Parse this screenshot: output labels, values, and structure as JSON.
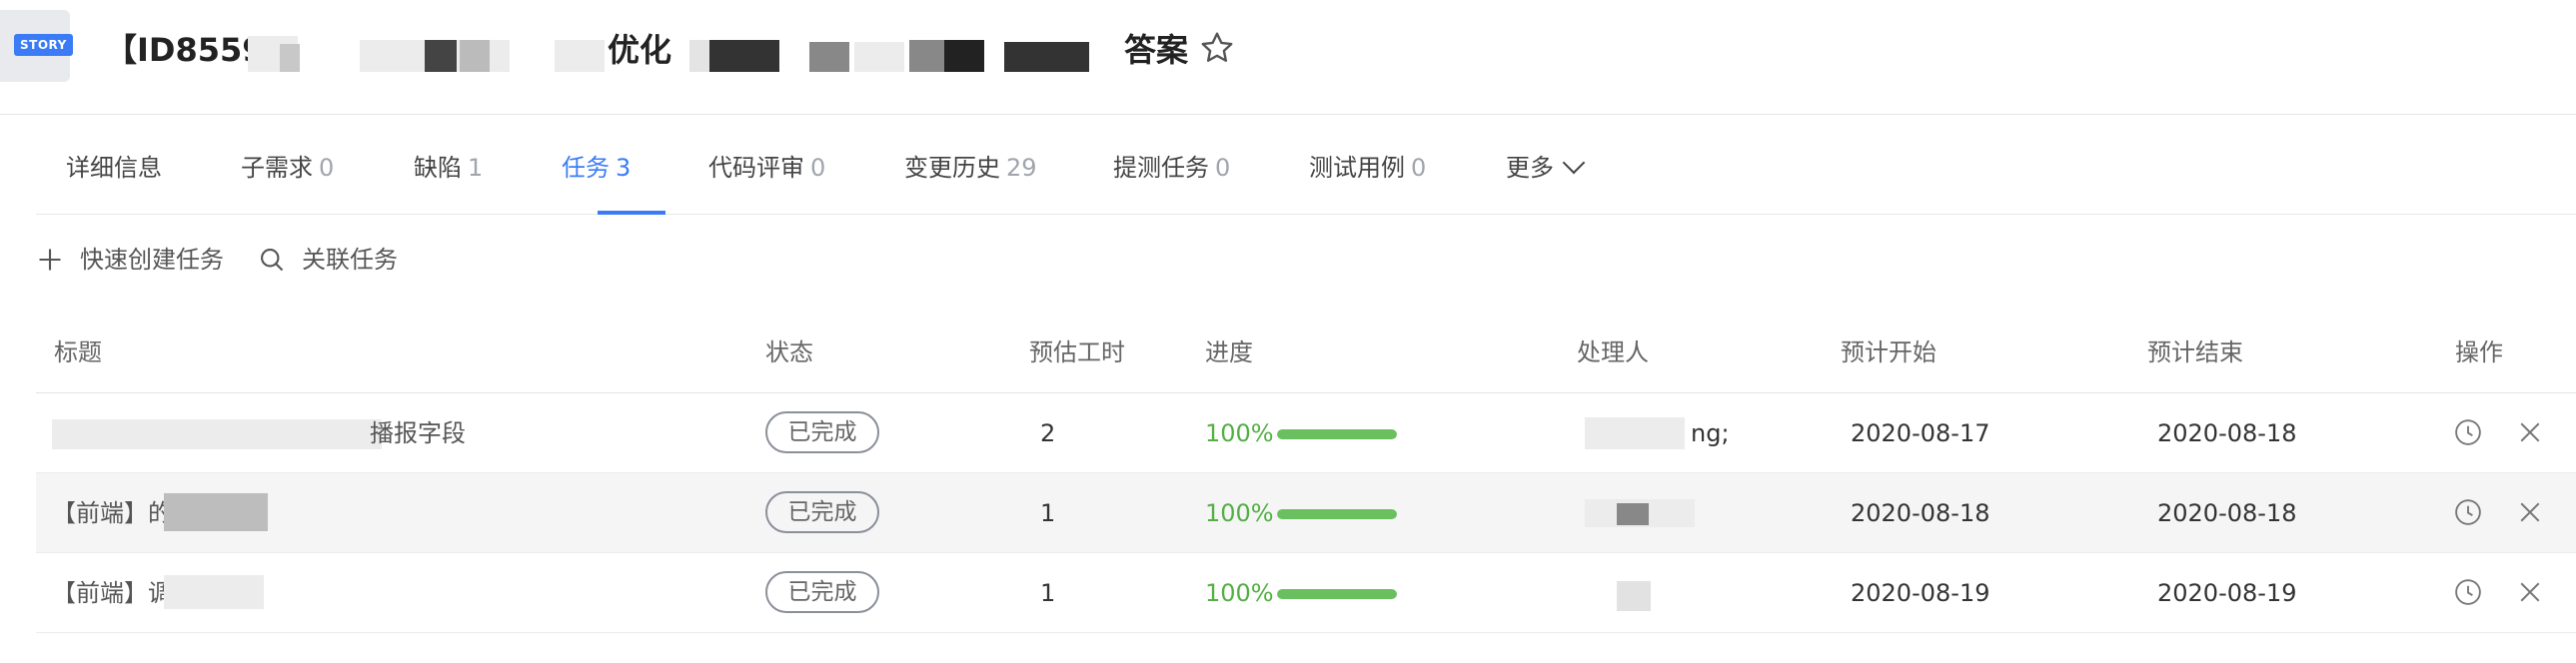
{
  "header": {
    "badge": "STORY",
    "title_start": "【ID8559",
    "title_mid": "优化",
    "title_end": "答案"
  },
  "tabs": [
    {
      "label": "详细信息",
      "count": ""
    },
    {
      "label": "子需求",
      "count": "0"
    },
    {
      "label": "缺陷",
      "count": "1"
    },
    {
      "label": "任务",
      "count": "3"
    },
    {
      "label": "代码评审",
      "count": "0"
    },
    {
      "label": "变更历史",
      "count": "29"
    },
    {
      "label": "提测任务",
      "count": "0"
    },
    {
      "label": "测试用例",
      "count": "0"
    },
    {
      "label": "更多",
      "count": ""
    }
  ],
  "active_tab": "任务",
  "toolbar": {
    "quick_create": "快速创建任务",
    "link_task": "关联任务"
  },
  "table": {
    "headers": [
      "标题",
      "状态",
      "预估工时",
      "进度",
      "处理人",
      "预计开始",
      "预计结束",
      "操作"
    ],
    "rows": [
      {
        "title": "播报字段",
        "status": "已完成",
        "hours": "2",
        "progress": "100%",
        "progress_value": 1.0,
        "assignee": "ng;",
        "start": "2020-08-17",
        "end": "2020-08-18"
      },
      {
        "title": "【前端】的支持",
        "status": "已完成",
        "hours": "1",
        "progress": "100%",
        "progress_value": 1.0,
        "assignee": "",
        "start": "2020-08-18",
        "end": "2020-08-18"
      },
      {
        "title": "【前端】调",
        "status": "已完成",
        "hours": "1",
        "progress": "100%",
        "progress_value": 1.0,
        "assignee": "",
        "start": "2020-08-19",
        "end": "2020-08-19"
      }
    ]
  },
  "colors": {
    "accent": "#3b7cf6",
    "success": "#52b043",
    "bar": "#6abf5e"
  },
  "icons": {
    "star": "star-outline-icon",
    "plus": "plus-icon",
    "search": "search-icon",
    "history": "clock-icon",
    "remove": "close-icon",
    "more": "chevron-down-icon"
  }
}
